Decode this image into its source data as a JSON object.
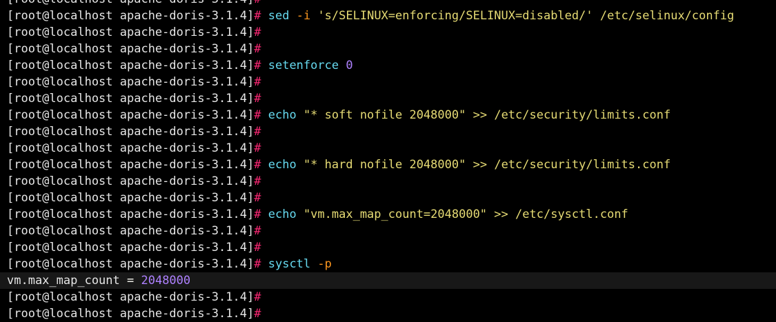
{
  "terminal": {
    "prompt": "[root@localhost apache-doris-3.1.4]",
    "hash": "#",
    "colors": {
      "background": "#000000",
      "text": "#e6e6e6",
      "hash": "#f92672",
      "command": "#66d9ef",
      "flag": "#fd971f",
      "string": "#e6db74",
      "number": "#ae81ff"
    },
    "lines": [
      {
        "kind": "prompt",
        "tokens": []
      },
      {
        "kind": "prompt",
        "tokens": [
          {
            "t": "cmd",
            "v": "sed"
          },
          {
            "t": "plain",
            "v": " "
          },
          {
            "t": "flag",
            "v": "-i"
          },
          {
            "t": "plain",
            "v": " "
          },
          {
            "t": "str",
            "v": "'s/SELINUX=enforcing/SELINUX=disabled/'"
          },
          {
            "t": "plain",
            "v": " "
          },
          {
            "t": "path",
            "v": "/etc/selinux/config"
          }
        ]
      },
      {
        "kind": "prompt",
        "tokens": []
      },
      {
        "kind": "prompt",
        "tokens": []
      },
      {
        "kind": "prompt",
        "tokens": [
          {
            "t": "cmd",
            "v": "setenforce"
          },
          {
            "t": "plain",
            "v": " "
          },
          {
            "t": "num",
            "v": "0"
          }
        ]
      },
      {
        "kind": "prompt",
        "tokens": []
      },
      {
        "kind": "prompt",
        "tokens": []
      },
      {
        "kind": "prompt",
        "tokens": [
          {
            "t": "cmd",
            "v": "echo"
          },
          {
            "t": "plain",
            "v": " "
          },
          {
            "t": "str",
            "v": "\"* soft nofile 2048000\""
          },
          {
            "t": "plain",
            "v": " "
          },
          {
            "t": "op",
            "v": ">>"
          },
          {
            "t": "plain",
            "v": " "
          },
          {
            "t": "path",
            "v": "/etc/security/limits.conf"
          }
        ]
      },
      {
        "kind": "prompt",
        "tokens": []
      },
      {
        "kind": "prompt",
        "tokens": []
      },
      {
        "kind": "prompt",
        "tokens": [
          {
            "t": "cmd",
            "v": "echo"
          },
          {
            "t": "plain",
            "v": " "
          },
          {
            "t": "str",
            "v": "\"* hard nofile 2048000\""
          },
          {
            "t": "plain",
            "v": " "
          },
          {
            "t": "op",
            "v": ">>"
          },
          {
            "t": "plain",
            "v": " "
          },
          {
            "t": "path",
            "v": "/etc/security/limits.conf"
          }
        ]
      },
      {
        "kind": "prompt",
        "tokens": []
      },
      {
        "kind": "prompt",
        "tokens": []
      },
      {
        "kind": "prompt",
        "tokens": [
          {
            "t": "cmd",
            "v": "echo"
          },
          {
            "t": "plain",
            "v": " "
          },
          {
            "t": "str",
            "v": "\"vm.max_map_count=2048000\""
          },
          {
            "t": "plain",
            "v": " "
          },
          {
            "t": "op",
            "v": ">>"
          },
          {
            "t": "plain",
            "v": " "
          },
          {
            "t": "path",
            "v": "/etc/sysctl.conf"
          }
        ]
      },
      {
        "kind": "prompt",
        "tokens": []
      },
      {
        "kind": "prompt",
        "tokens": []
      },
      {
        "kind": "prompt",
        "tokens": [
          {
            "t": "cmd",
            "v": "sysctl"
          },
          {
            "t": "plain",
            "v": " "
          },
          {
            "t": "flag",
            "v": "-p"
          }
        ]
      },
      {
        "kind": "output",
        "highlight": true,
        "tokens": [
          {
            "t": "out",
            "v": "vm.max_map_count"
          },
          {
            "t": "eq",
            "v": " = "
          },
          {
            "t": "num",
            "v": "2048000"
          }
        ]
      },
      {
        "kind": "prompt",
        "tokens": []
      },
      {
        "kind": "prompt",
        "tokens": []
      }
    ]
  }
}
